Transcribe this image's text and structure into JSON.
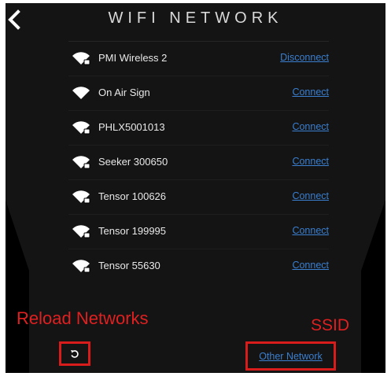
{
  "header": {
    "title": "WIFI NETWORK",
    "back_icon": "chevron-left-icon"
  },
  "networks": [
    {
      "ssid": "PMI Wireless 2",
      "action": "Disconnect",
      "secured": true
    },
    {
      "ssid": "On Air Sign",
      "action": "Connect",
      "secured": false
    },
    {
      "ssid": "PHLX5001013",
      "action": "Connect",
      "secured": true
    },
    {
      "ssid": "Seeker 300650",
      "action": "Connect",
      "secured": true
    },
    {
      "ssid": "Tensor 100626",
      "action": "Connect",
      "secured": true
    },
    {
      "ssid": "Tensor 199995",
      "action": "Connect",
      "secured": true
    },
    {
      "ssid": "Tensor 55630",
      "action": "Connect",
      "secured": true
    }
  ],
  "footer": {
    "reload_icon": "reload-icon",
    "other_network_label": "Other Network"
  },
  "annotations": {
    "reload_label": "Reload Networks",
    "ssid_label": "SSID",
    "color": "#d81c1c"
  },
  "colors": {
    "link": "#3a7fd0",
    "background": "#000000",
    "text": "#e8e8e8"
  }
}
